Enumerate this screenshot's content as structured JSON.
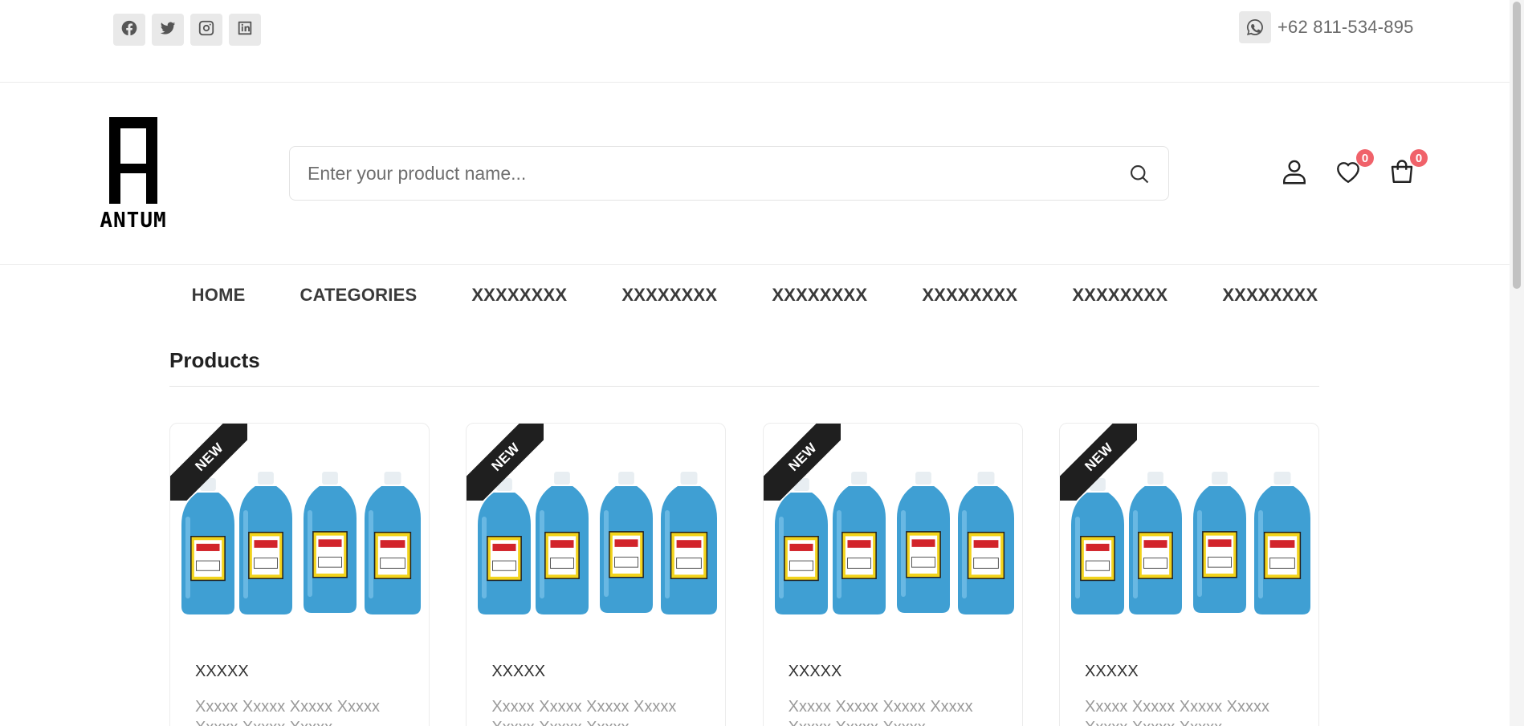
{
  "topbar": {
    "socials": [
      {
        "name": "facebook-icon"
      },
      {
        "name": "twitter-icon"
      },
      {
        "name": "instagram-icon"
      },
      {
        "name": "linkedin-icon"
      }
    ],
    "phone": "+62 811-534-895"
  },
  "header": {
    "logo_text": "ANTUM",
    "search_placeholder": "Enter your product name...",
    "wishlist_count": "0",
    "cart_count": "0"
  },
  "nav": {
    "items": [
      "HOME",
      "CATEGORIES",
      "XXXXXXXX",
      "XXXXXXXX",
      "XXXXXXXX",
      "XXXXXXXX",
      "XXXXXXXX",
      "XXXXXXXX"
    ]
  },
  "products": {
    "title": "Products",
    "items": [
      {
        "badge": "NEW",
        "name": "XXXXX",
        "desc": "Xxxxx Xxxxx Xxxxx Xxxxx Xxxxx Xxxxx Xxxxx"
      },
      {
        "badge": "NEW",
        "name": "XXXXX",
        "desc": "Xxxxx Xxxxx Xxxxx Xxxxx Xxxxx Xxxxx Xxxxx"
      },
      {
        "badge": "NEW",
        "name": "XXXXX",
        "desc": "Xxxxx Xxxxx Xxxxx Xxxxx Xxxxx Xxxxx Xxxxx"
      },
      {
        "badge": "NEW",
        "name": "XXXXX",
        "desc": "Xxxxx Xxxxx Xxxxx Xxxxx Xxxxx Xxxxx Xxxxx"
      }
    ]
  },
  "colors": {
    "badge": "#f0626a",
    "ribbon": "#1f1f1f",
    "bottle": "#3f9fd3",
    "label_yellow": "#f2d31b",
    "label_red": "#d2242b"
  }
}
